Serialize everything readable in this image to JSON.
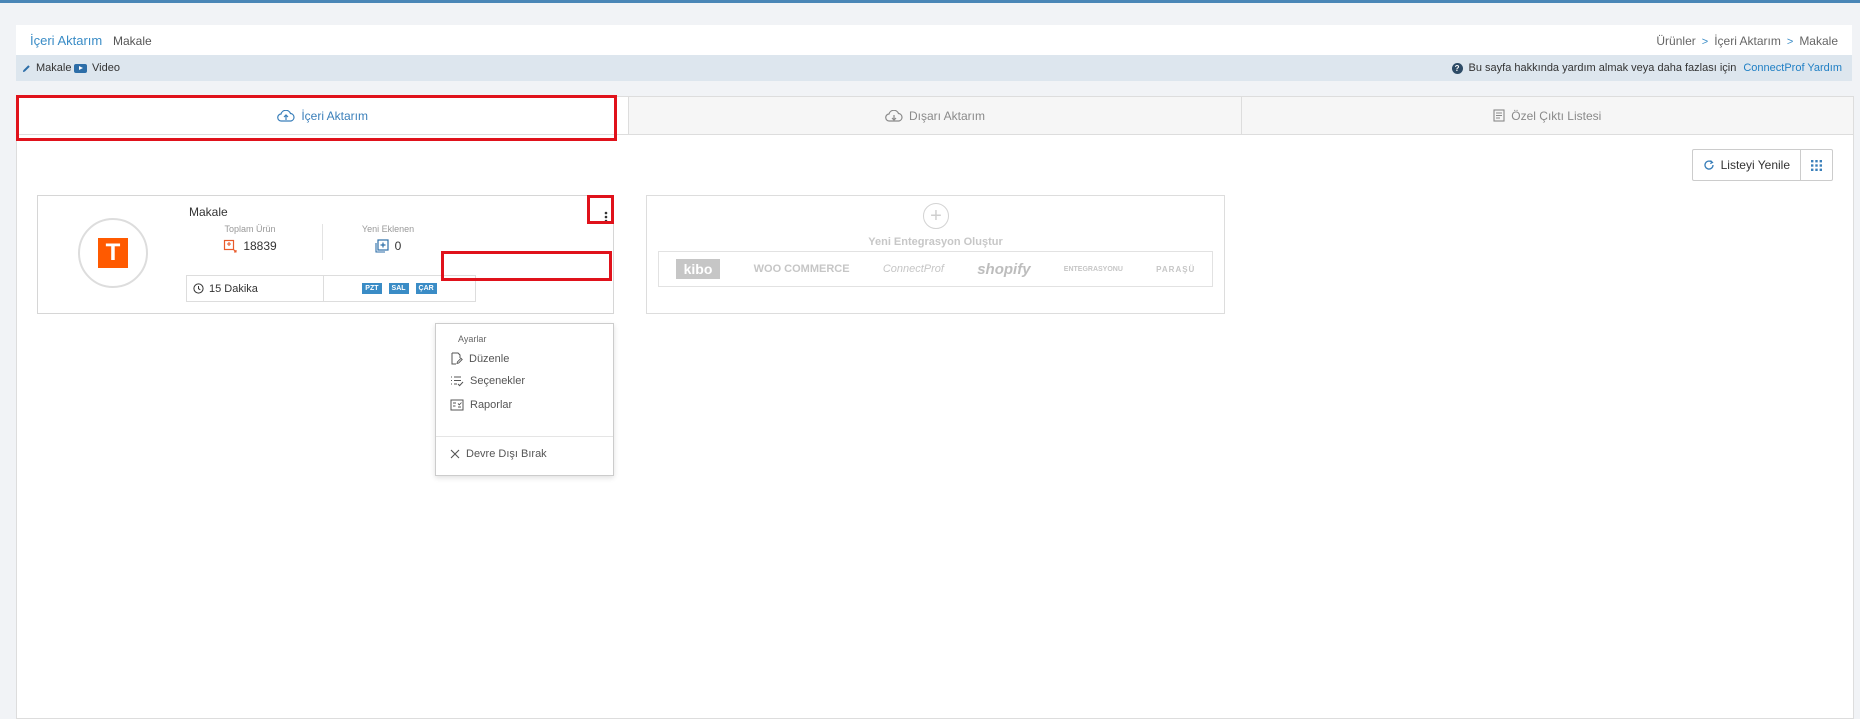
{
  "header": {
    "title": "İçeri Aktarım",
    "subtitle": "Makale",
    "breadcrumb": [
      "Ürünler",
      "İçeri Aktarım",
      "Makale"
    ],
    "breadcrumb_sep": ">"
  },
  "subbar": {
    "makale_link": "Makale",
    "video_link": "Video",
    "help_text": "Bu sayfa hakkında yardım almak veya daha fazlası için",
    "help_link": "ConnectProf Yardım"
  },
  "tabs": [
    {
      "label": "İçeri Aktarım",
      "icon": "cloud-upload-icon",
      "active": true
    },
    {
      "label": "Dışarı Aktarım",
      "icon": "cloud-download-icon",
      "active": false
    },
    {
      "label": "Özel Çıktı Listesi",
      "icon": "list-icon",
      "active": false
    }
  ],
  "toolbar": {
    "refresh_label": "Listeyi Yenile"
  },
  "card": {
    "name": "Makale",
    "avatar_letter": "T",
    "stats": [
      {
        "label": "Toplam Ürün",
        "value": "18839"
      },
      {
        "label": "Yeni Eklenen",
        "value": "0"
      }
    ],
    "interval": "15 Dakika",
    "days": [
      "PZT",
      "SAL",
      "ÇAR"
    ]
  },
  "menu": {
    "header": "Ayarlar",
    "items": [
      "Düzenle",
      "Seçenekler",
      "Raporlar",
      "Devre Dışı Bırak"
    ]
  },
  "new_integration": {
    "title": "Yeni Entegrasyon Oluştur",
    "logos": [
      "kibo",
      "WOO COMMERCE",
      "ConnectProf",
      "shopify",
      "ENTEGRASYONU",
      "PARAŞÜ"
    ]
  },
  "colors": {
    "accent": "#3a8cc6",
    "highlight": "#e0121b",
    "brand_orange": "#ff5a00"
  }
}
